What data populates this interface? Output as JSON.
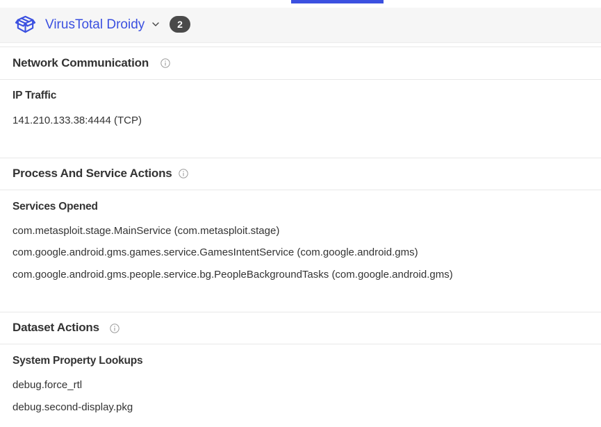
{
  "header": {
    "app_name": "VirusTotal Droidy",
    "badge_count": "2",
    "logo_icon": "virustotal-box-icon",
    "accent_color": "#3b50e0"
  },
  "sections": {
    "network": {
      "title": "Network Communication",
      "subsection_title": "IP Traffic",
      "items": [
        "141.210.133.38:4444 (TCP)"
      ]
    },
    "process": {
      "title": "Process And Service Actions",
      "subsection_title": "Services Opened",
      "items": [
        "com.metasploit.stage.MainService (com.metasploit.stage)",
        "com.google.android.gms.games.service.GamesIntentService (com.google.android.gms)",
        "com.google.android.gms.people.service.bg.PeopleBackgroundTasks (com.google.android.gms)"
      ]
    },
    "dataset": {
      "title": "Dataset Actions",
      "subsection_title": "System Property Lookups",
      "items": [
        "debug.force_rtl",
        "debug.second-display.pkg"
      ]
    }
  }
}
